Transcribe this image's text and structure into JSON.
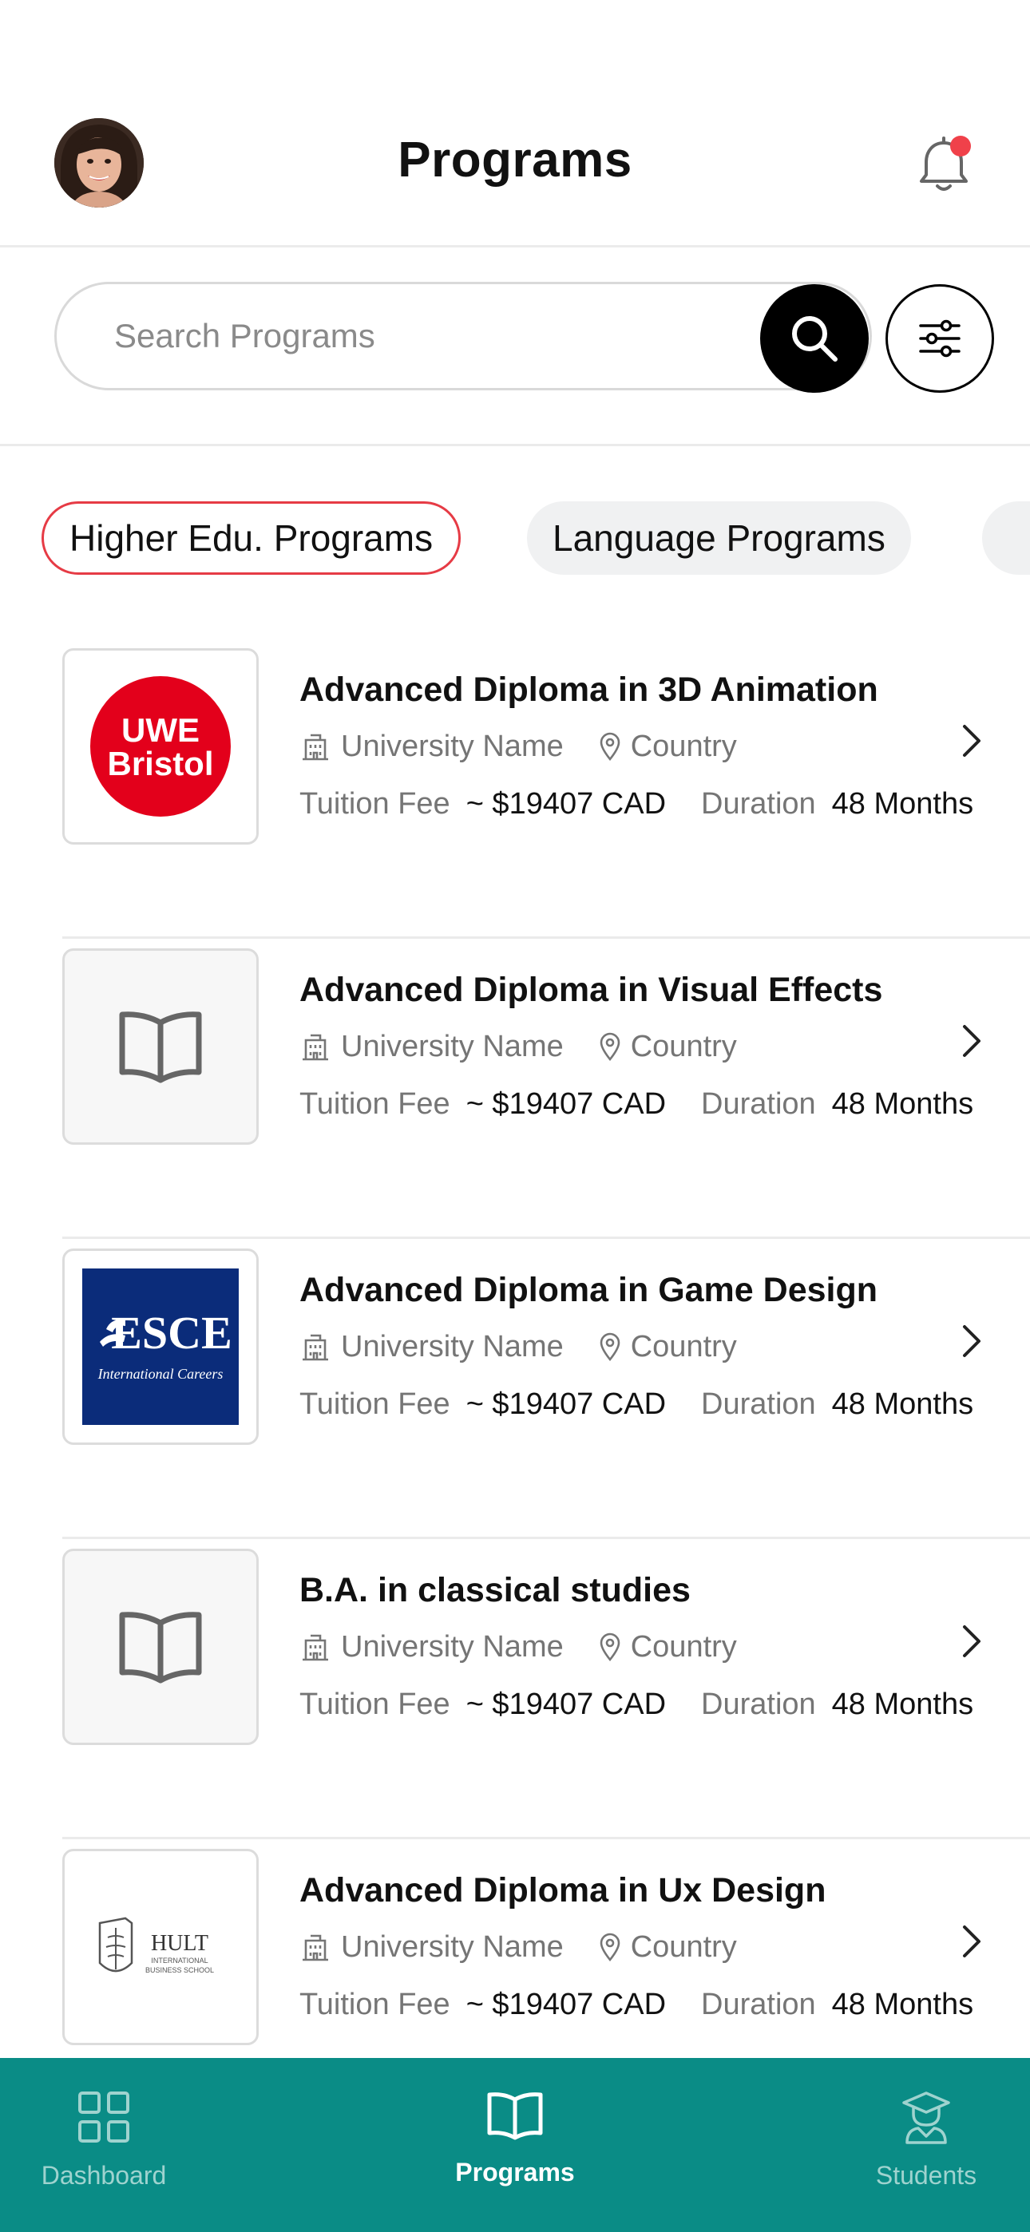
{
  "header": {
    "title": "Programs",
    "avatar": "user-avatar",
    "notification_icon": "bell-icon",
    "has_notification": true,
    "notification_dot_color": "#f0414a"
  },
  "search": {
    "placeholder": "Search Programs",
    "value": ""
  },
  "tabs": [
    {
      "label": "Higher Edu. Programs",
      "active": true
    },
    {
      "label": "Language Programs",
      "active": false
    }
  ],
  "programs": [
    {
      "title": "Advanced Diploma in 3D Animation",
      "university": "University Name",
      "country": "Country",
      "fee_label": "Tuition Fee",
      "fee": "~ $19407 CAD",
      "duration_label": "Duration",
      "duration": "48 Months",
      "logo": {
        "type": "uwe",
        "line1": "UWE",
        "line2": "Bristol",
        "color": "#e3001b"
      }
    },
    {
      "title": "Advanced Diploma in Visual Effects",
      "university": "University Name",
      "country": "Country",
      "fee_label": "Tuition Fee",
      "fee": "~ $19407 CAD",
      "duration_label": "Duration",
      "duration": "48 Months",
      "logo": {
        "type": "placeholder"
      }
    },
    {
      "title": "Advanced Diploma in Game Design",
      "university": "University Name",
      "country": "Country",
      "fee_label": "Tuition Fee",
      "fee": "~ $19407 CAD",
      "duration_label": "Duration",
      "duration": "48 Months",
      "logo": {
        "type": "esce",
        "line1": "ESCE",
        "line2": "International Careers",
        "color": "#0b2c7a"
      }
    },
    {
      "title": "B.A. in classical studies",
      "university": "University Name",
      "country": "Country",
      "fee_label": "Tuition Fee",
      "fee": "~ $19407 CAD",
      "duration_label": "Duration",
      "duration": "48 Months",
      "logo": {
        "type": "placeholder"
      }
    },
    {
      "title": "Advanced Diploma in Ux Design",
      "university": "University Name",
      "country": "Country",
      "fee_label": "Tuition Fee",
      "fee": "~ $19407 CAD",
      "duration_label": "Duration",
      "duration": "48 Months",
      "logo": {
        "type": "hult",
        "line1": "HULT",
        "line2": "INTERNATIONAL",
        "line3": "BUSINESS SCHOOL"
      }
    }
  ],
  "bottom_nav": {
    "background": "#0a8c86",
    "items": [
      {
        "label": "Dashboard",
        "icon": "grid-icon",
        "active": false
      },
      {
        "label": "Programs",
        "icon": "book-icon",
        "active": true
      },
      {
        "label": "Students",
        "icon": "graduate-icon",
        "active": false
      }
    ]
  }
}
